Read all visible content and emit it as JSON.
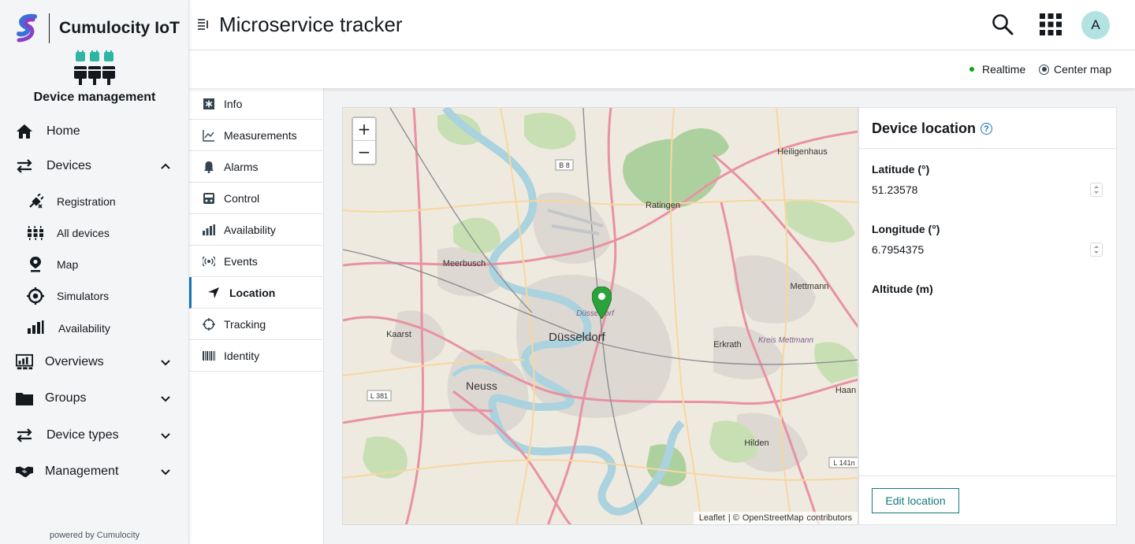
{
  "brand": {
    "name": "Cumulocity IoT"
  },
  "app": {
    "title": "Device management"
  },
  "nav": {
    "home": "Home",
    "devices": "Devices",
    "devices_sub": [
      "Registration",
      "All devices",
      "Map",
      "Simulators",
      "Availability"
    ],
    "overviews": "Overviews",
    "groups": "Groups",
    "device_types": "Device types",
    "management": "Management",
    "powered": "powered by Cumulocity"
  },
  "header": {
    "title": "Microservice tracker",
    "avatar": "A"
  },
  "actionbar": {
    "realtime": "Realtime",
    "center_map": "Center map",
    "realtime_color": "#10a310"
  },
  "tabs": [
    "Info",
    "Measurements",
    "Alarms",
    "Control",
    "Availability",
    "Events",
    "Location",
    "Tracking",
    "Identity"
  ],
  "active_tab": "Location",
  "map": {
    "zoom_in": "+",
    "zoom_out": "−",
    "attribution": {
      "leaflet": "Leaflet",
      "sep": "| ©",
      "osm": "OpenStreetMap",
      "contributors": "contributors"
    },
    "places": [
      "Düsseldorf",
      "Neuss",
      "Ratingen",
      "Meerbusch",
      "Kaarst",
      "Erkrath",
      "Hilden",
      "Haan",
      "Mettmann",
      "Heiligenhaus",
      "Kreis Mettmann",
      "Düsseldorf"
    ],
    "road_labels": [
      "B 8",
      "L 381",
      "L 141n"
    ],
    "marker_color": "#2aa43a"
  },
  "location": {
    "title": "Device location",
    "latitude_label": "Latitude (°)",
    "latitude": "51.23578",
    "longitude_label": "Longitude (°)",
    "longitude": "6.7954375",
    "altitude_label": "Altitude (m)",
    "edit_button": "Edit location"
  },
  "colors": {
    "accent": "#1776bf",
    "teal": "#13797e",
    "nav_bg": "#f4f5f6"
  }
}
